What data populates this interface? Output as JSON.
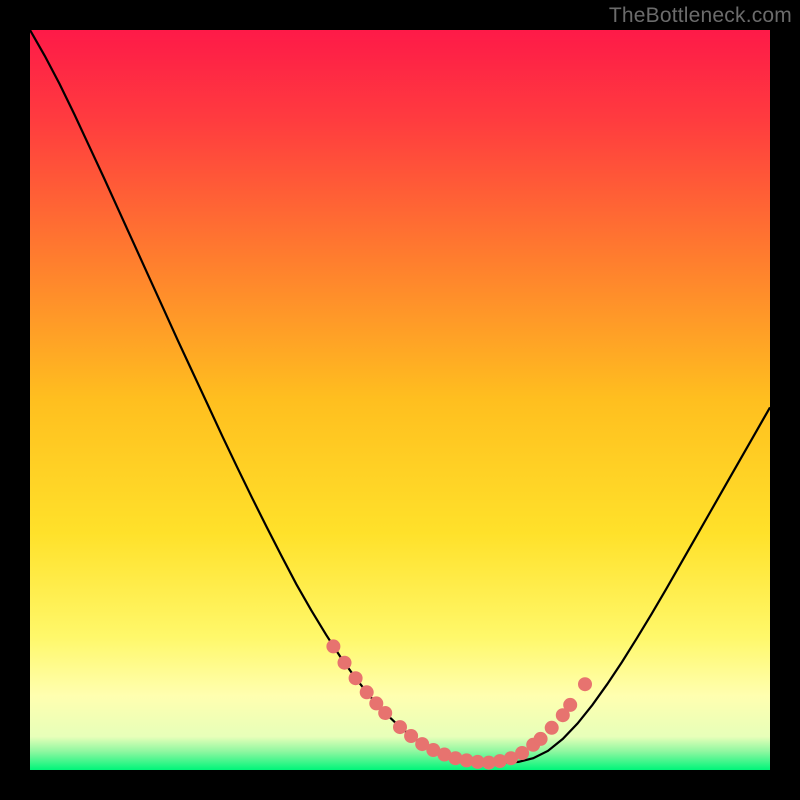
{
  "watermark": "TheBottleneck.com",
  "accent_colors": {
    "top_gradient": "#fe1a48",
    "mid_gradient": "#ffd500",
    "low_gradient_pale": "#ffffb0",
    "bottom_band": "#00f57a",
    "curve": "#000000",
    "dots": "#e7736f",
    "frame": "#000000"
  },
  "chart_data": {
    "type": "line",
    "title": "",
    "xlabel": "",
    "ylabel": "",
    "xlim": [
      0,
      100
    ],
    "ylim": [
      0,
      100
    ],
    "x": [
      0,
      2,
      4,
      6,
      8,
      10,
      12,
      14,
      16,
      18,
      20,
      22,
      24,
      26,
      28,
      30,
      32,
      34,
      36,
      38,
      40,
      42,
      44,
      46,
      48,
      50,
      52,
      54,
      56,
      58,
      60,
      62,
      64,
      66,
      68,
      70,
      72,
      74,
      76,
      78,
      80,
      82,
      84,
      86,
      88,
      90,
      92,
      94,
      96,
      98,
      100
    ],
    "values": [
      100,
      96.5,
      92.7,
      88.6,
      84.3,
      80.0,
      75.6,
      71.2,
      66.8,
      62.4,
      58.0,
      53.7,
      49.4,
      45.1,
      40.9,
      36.8,
      32.8,
      28.9,
      25.1,
      21.6,
      18.3,
      15.2,
      12.4,
      9.9,
      7.7,
      5.8,
      4.2,
      3.0,
      2.1,
      1.5,
      1.1,
      1.0,
      1.0,
      1.1,
      1.6,
      2.6,
      4.2,
      6.3,
      8.8,
      11.6,
      14.6,
      17.8,
      21.1,
      24.5,
      28.0,
      31.5,
      35.0,
      38.5,
      42.0,
      45.5,
      49.0
    ],
    "dotted_region_x": [
      40,
      74
    ],
    "dot_points": [
      {
        "x": 41.0,
        "y": 16.7
      },
      {
        "x": 42.5,
        "y": 14.5
      },
      {
        "x": 44.0,
        "y": 12.4
      },
      {
        "x": 45.5,
        "y": 10.5
      },
      {
        "x": 46.8,
        "y": 9.0
      },
      {
        "x": 48.0,
        "y": 7.7
      },
      {
        "x": 50.0,
        "y": 5.8
      },
      {
        "x": 51.5,
        "y": 4.6
      },
      {
        "x": 53.0,
        "y": 3.5
      },
      {
        "x": 54.5,
        "y": 2.7
      },
      {
        "x": 56.0,
        "y": 2.1
      },
      {
        "x": 57.5,
        "y": 1.6
      },
      {
        "x": 59.0,
        "y": 1.3
      },
      {
        "x": 60.5,
        "y": 1.1
      },
      {
        "x": 62.0,
        "y": 1.0
      },
      {
        "x": 63.5,
        "y": 1.2
      },
      {
        "x": 65.0,
        "y": 1.6
      },
      {
        "x": 66.5,
        "y": 2.3
      },
      {
        "x": 68.0,
        "y": 3.4
      },
      {
        "x": 69.0,
        "y": 4.2
      },
      {
        "x": 70.5,
        "y": 5.7
      },
      {
        "x": 72.0,
        "y": 7.4
      },
      {
        "x": 73.0,
        "y": 8.8
      },
      {
        "x": 75.0,
        "y": 11.6
      }
    ],
    "gradient_stops": [
      {
        "pos": 0.0,
        "color": "#fe1a48"
      },
      {
        "pos": 0.12,
        "color": "#ff3b3f"
      },
      {
        "pos": 0.3,
        "color": "#ff7a2f"
      },
      {
        "pos": 0.5,
        "color": "#ffbf1f"
      },
      {
        "pos": 0.68,
        "color": "#ffe12a"
      },
      {
        "pos": 0.82,
        "color": "#fff86a"
      },
      {
        "pos": 0.9,
        "color": "#ffffb0"
      },
      {
        "pos": 0.955,
        "color": "#e7ffb9"
      },
      {
        "pos": 0.975,
        "color": "#8ef7a0"
      },
      {
        "pos": 1.0,
        "color": "#00f57a"
      }
    ]
  }
}
